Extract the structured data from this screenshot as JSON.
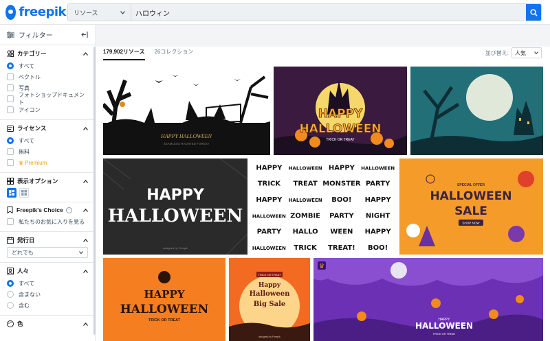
{
  "header": {
    "logo_text": "freepik",
    "resource_select": "リソース",
    "search_value": "ハロウィン",
    "search_placeholder": "ハロウィン"
  },
  "sidebar": {
    "filter_label": "フィルター",
    "category": {
      "title": "カテゴリー",
      "options": [
        "すべて",
        "ベクトル",
        "写真",
        "フォトショップドキュメント",
        "アイコン"
      ]
    },
    "license": {
      "title": "ライセンス",
      "options": [
        "すべて",
        "無料",
        "Premium"
      ]
    },
    "display": {
      "title": "表示オプション"
    },
    "choice": {
      "title": "Freepik's Choice",
      "option": "私たちのお気に入りを見る"
    },
    "date": {
      "title": "発行日",
      "value": "どれでも"
    },
    "people": {
      "title": "人々",
      "options": [
        "すべて",
        "含まない",
        "含む"
      ]
    },
    "color": {
      "title": "色"
    }
  },
  "main": {
    "tabs": [
      "179,902リソース",
      "26コレクション"
    ],
    "sort_label": "並び替え:",
    "sort_value": "人気"
  },
  "thumbnails": [
    {
      "title": "HAPPY HALLOWEEN",
      "sub": "SEAMLESS HAUNTED FOREST"
    },
    {
      "line1": "HAPPY",
      "line2": "HALLOWEEN",
      "sub": "TRICK OR TREAT"
    },
    {
      "label": ""
    },
    {
      "line1": "HAPPY",
      "line2": "HALLOWEEN",
      "credit": "designed by Freepik"
    },
    {
      "words": [
        "HAPPY",
        "HALLOWEEN",
        "HAPPY",
        "HALLOWEEN",
        "TRICK",
        "TREAT",
        "MONSTER",
        "PARTY",
        "HAPPY",
        "HALLOWEEN",
        "BOO!",
        "HAPPY",
        "HALLOWEEN",
        "ZOMBIE",
        "PARTY",
        "NIGHT",
        "PARTY",
        "HALLO",
        "WEEN",
        "HAPPY",
        "HALLOWEEN",
        "TRICK",
        "TREAT!",
        "BOO!"
      ]
    },
    {
      "special": "SPECIAL OFFER",
      "line1": "HALLOWEEN",
      "line2": "SALE",
      "button": "SHOP NOW"
    },
    {
      "line1": "HAPPY",
      "line2": "HALLOWEEN",
      "sub": "TRICK OR TREAT"
    },
    {
      "tag": "TRICK OR TREAT",
      "line1": "Happy",
      "line2": "Halloween",
      "line3": "Big Sale",
      "credit": "designed by Freepik"
    },
    {
      "line1": "HAPPY",
      "line2": "HALLOWEEN",
      "sub": "TRICK OR TREAT"
    }
  ],
  "colors": {
    "accent": "#1273eb",
    "premium": "#f0a000"
  }
}
